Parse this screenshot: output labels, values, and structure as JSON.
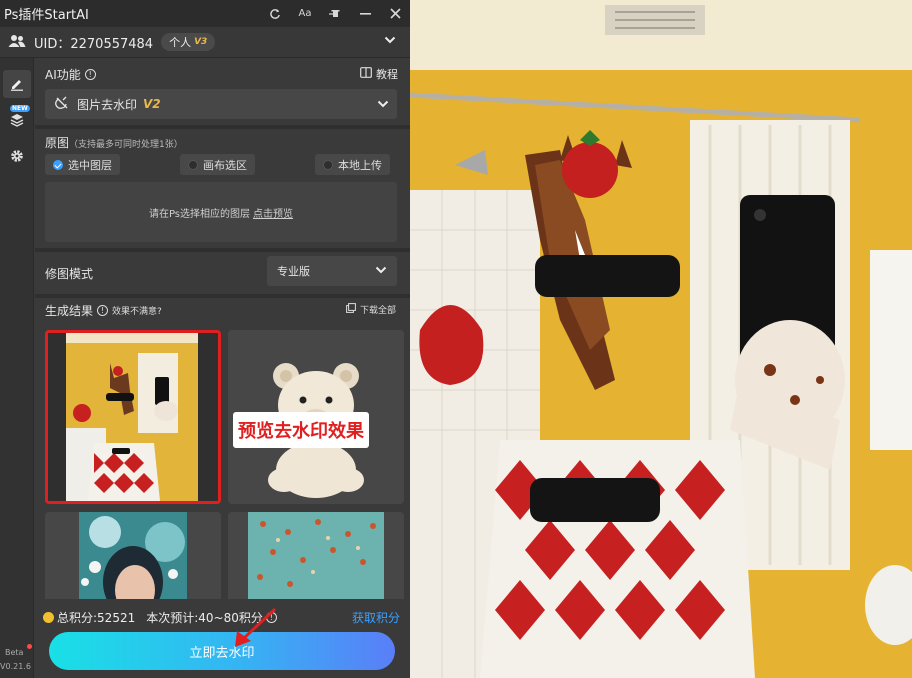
{
  "app": {
    "title": "Ps插件StartAI"
  },
  "titlebar_icons": [
    "refresh-icon",
    "font-size-icon",
    "pin-icon",
    "minimize-icon",
    "close-icon"
  ],
  "user": {
    "uid": "UID：2270557484",
    "plan": "个人",
    "plan_level": "V3"
  },
  "sidebar": {
    "items": [
      "edit-icon",
      "layers-icon",
      "settings-icon"
    ],
    "new_tag": "NEW",
    "beta": "Beta",
    "version": "V0.21.6"
  },
  "ai_function": {
    "label": "AI功能",
    "tutorial": "教程",
    "selected": "图片去水印",
    "selected_version": "V2"
  },
  "source": {
    "label": "原图",
    "hint": "（支持最多可同时处理1张）",
    "options": [
      "选中图层",
      "画布选区",
      "本地上传"
    ],
    "selected_option": "选中图层",
    "drop_text": "请在Ps选择相应的图层",
    "preview_link": "点击预览"
  },
  "mode": {
    "label": "修图模式",
    "value": "专业版"
  },
  "results": {
    "label": "生成结果",
    "unsatisfied": "效果不满意?",
    "download_all": "下载全部",
    "callout": "预览去水印效果"
  },
  "footer": {
    "total_points": "总积分:52521",
    "estimate": "本次预计:40~80积分",
    "get_points": "获取积分",
    "action_button": "立即去水印"
  },
  "colors": {
    "accent": "#3aa0ff",
    "highlight": "#e02020",
    "gold": "#e8b84a",
    "panel_bg": "#3a3a3a"
  }
}
